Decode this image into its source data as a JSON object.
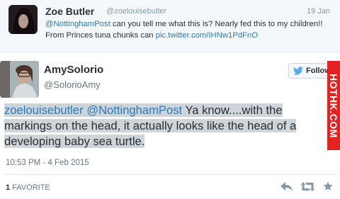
{
  "top_tweet": {
    "name": "Zoe Butler",
    "handle": "@zoelouisebutler",
    "date": "19 Jan",
    "mention": "@NottinghamPost",
    "text": " can you tell me what this is? Nearly fed this to my children!! From Princes tuna chunks can ",
    "link": "pic.twitter.com/IHNw1PdFnO"
  },
  "main_tweet": {
    "name": "AmySolorio",
    "handle": "@SolorioAmy",
    "follow_label": "Follow",
    "text_mentions": "zoelouisebutler @NottinghamPost",
    "text_body": " Ya know....with the markings on the head, it actually looks like the head of a developing baby sea turtle.",
    "timestamp": "10:53 PM - 4 Feb 2015",
    "favorites_count": "1",
    "favorites_label": "FAVORITE",
    "watermark": "HOTHK.COM"
  },
  "icons": {
    "reply": "reply-icon",
    "retweet": "retweet-icon",
    "favorite": "star-icon",
    "twitter": "bird-icon"
  },
  "colors": {
    "link": "#2b7bb9",
    "watermark_bg": "#e32222",
    "highlight": "#cfd4d8"
  }
}
